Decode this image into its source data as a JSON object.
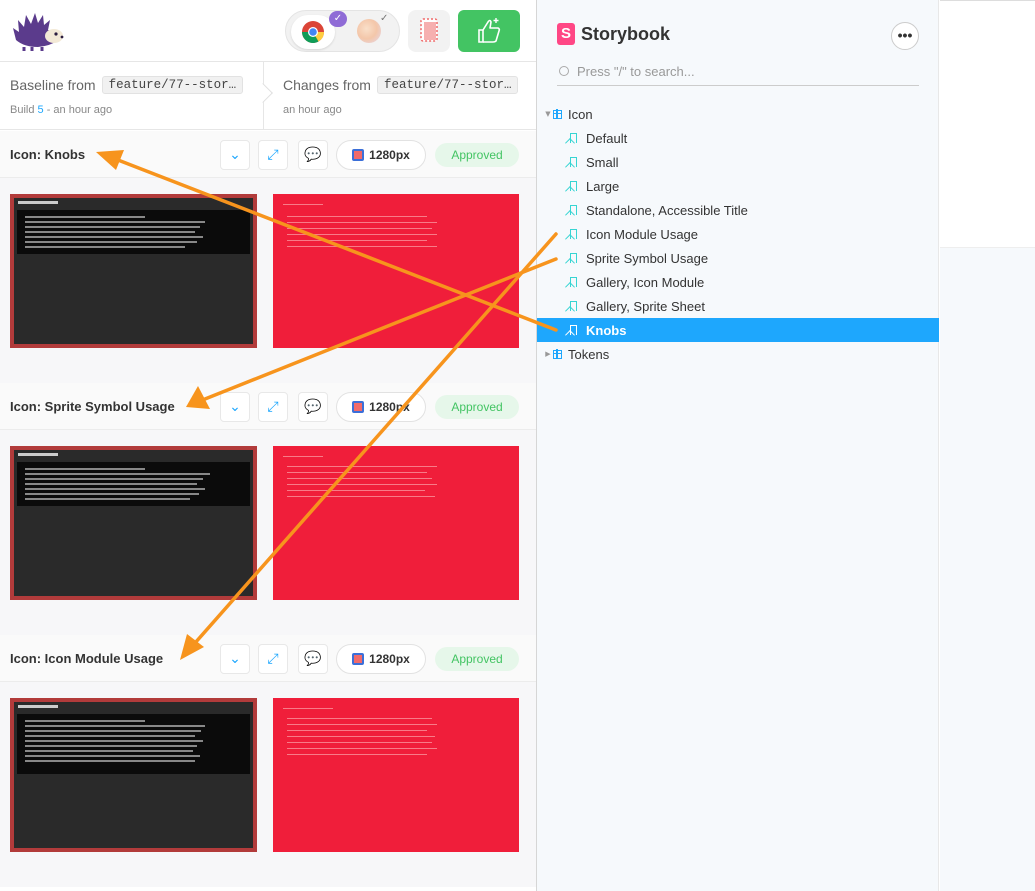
{
  "header": {
    "app_logo": "hedgehog-logo",
    "browsers": [
      {
        "name": "Chrome",
        "icon": "chrome-icon",
        "selected": true
      },
      {
        "name": "Firefox",
        "icon": "firefox-icon",
        "selected": false
      }
    ],
    "accent_purple": "#8f6bd6",
    "approve_color": "#43c463"
  },
  "comparison": {
    "baseline_label": "Baseline from",
    "baseline_branch": "feature/77--stor…",
    "baseline_build_prefix": "Build",
    "baseline_build_num": "5",
    "baseline_time": " - an hour ago",
    "changes_label": "Changes from",
    "changes_branch": "feature/77--stor…",
    "changes_time": "an hour ago"
  },
  "stories": [
    {
      "title": "Icon: Knobs",
      "viewport": "1280px",
      "status": "Approved"
    },
    {
      "title": "Icon: Sprite Symbol Usage",
      "viewport": "1280px",
      "status": "Approved"
    },
    {
      "title": "Icon: Icon Module Usage",
      "viewport": "1280px",
      "status": "Approved"
    }
  ],
  "storybook": {
    "title": "Storybook",
    "logo_letter": "S",
    "menu_glyph": "•••",
    "search_placeholder": "Press \"/\" to search...",
    "brand_color": "#ff4785",
    "selected_color": "#1ea7fd",
    "tree": [
      {
        "label": "Icon",
        "kind": "component",
        "expanded": true
      },
      {
        "label": "Default",
        "kind": "story"
      },
      {
        "label": "Small",
        "kind": "story"
      },
      {
        "label": "Large",
        "kind": "story"
      },
      {
        "label": "Standalone, Accessible Title",
        "kind": "story"
      },
      {
        "label": "Icon Module Usage",
        "kind": "story"
      },
      {
        "label": "Sprite Symbol Usage",
        "kind": "story"
      },
      {
        "label": "Gallery, Icon Module",
        "kind": "story"
      },
      {
        "label": "Gallery, Sprite Sheet",
        "kind": "story"
      },
      {
        "label": "Knobs",
        "kind": "story",
        "selected": true
      },
      {
        "label": "Tokens",
        "kind": "component",
        "expanded": false
      }
    ]
  },
  "annotation_color": "#f7941d"
}
